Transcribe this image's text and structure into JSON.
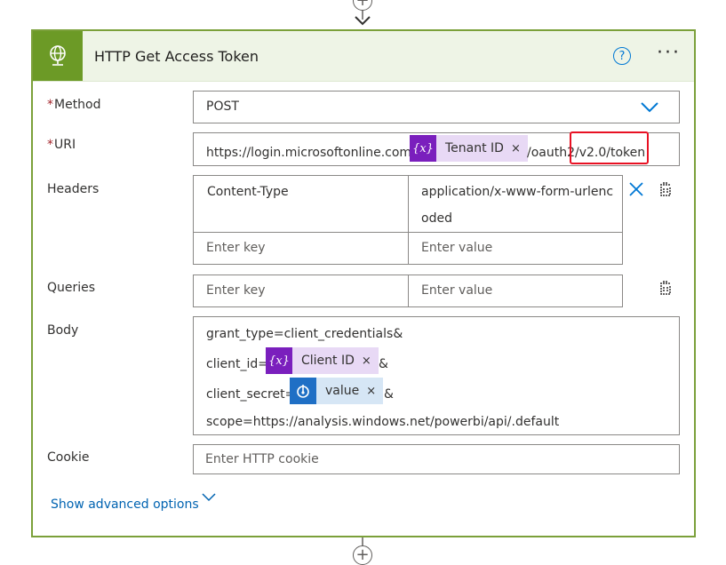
{
  "card": {
    "title": "HTTP Get Access Token",
    "help_icon": "question-circle-icon",
    "more_icon": "more-ellipsis-icon",
    "header_icon": "globe-icon"
  },
  "method": {
    "label": "Method",
    "required_mark": "*",
    "value": "POST"
  },
  "uri": {
    "label": "URI",
    "required_mark": "*",
    "prefix": "https://login.microsoftonline.com/",
    "token": {
      "icon_text": "{x}",
      "label": "Tenant ID",
      "close": "×"
    },
    "suffix": "/oauth2/v2.0/token"
  },
  "headers": {
    "label": "Headers",
    "rows": [
      {
        "key": "Content-Type",
        "value_line1": "application/x-www-form-urlenc",
        "value_line2": "oded"
      }
    ],
    "key_placeholder": "Enter key",
    "value_placeholder": "Enter value"
  },
  "queries": {
    "label": "Queries",
    "key_placeholder": "Enter key",
    "value_placeholder": "Enter value"
  },
  "body": {
    "label": "Body",
    "line1": "grant_type=client_credentials&",
    "line2_prefix": "client_id=",
    "client_token": {
      "icon_text": "{x}",
      "label": "Client ID",
      "close": "×"
    },
    "line2_suffix": "&",
    "line3_prefix": "client_secret=",
    "secret_token": {
      "label": "value",
      "close": "×"
    },
    "line3_suffix": "&",
    "line4": "scope=https://analysis.windows.net/powerbi/api/.default"
  },
  "cookie": {
    "label": "Cookie",
    "placeholder": "Enter HTTP cookie"
  },
  "advanced": {
    "label": "Show advanced options"
  },
  "connector": {
    "plus": "+"
  },
  "colors": {
    "accent": "#0078d4",
    "header_green": "#6c9a26",
    "border_green": "#7ba03a",
    "highlight_red": "#e81123",
    "variable_purple": "#7a1fbd"
  }
}
